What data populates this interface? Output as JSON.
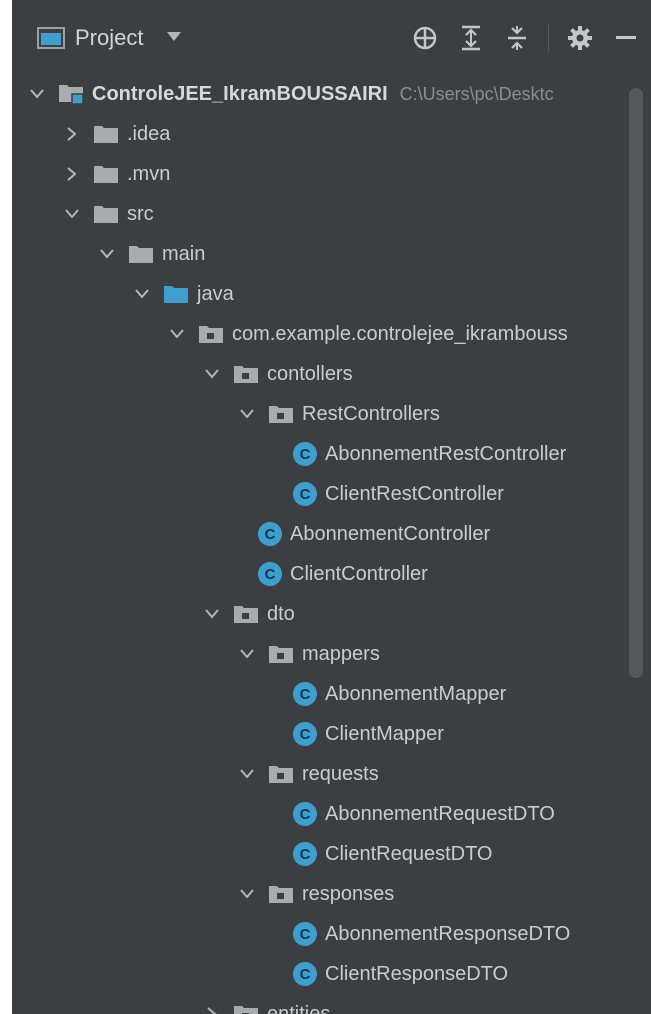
{
  "toolbar": {
    "title": "Project",
    "icons": [
      "locate-icon",
      "expand-all-icon",
      "collapse-all-icon",
      "gear-icon",
      "minimize-icon"
    ]
  },
  "colors": {
    "background": "#3c3f41",
    "text": "#c9cdd1",
    "folder": "#a9acaf",
    "java_folder": "#3e9fcf",
    "class_badge": "#3e9fcf"
  },
  "tree": [
    {
      "label": "ControleJEE_IkramBOUSSAIRI",
      "path": "C:\\Users\\pc\\Desktc",
      "depth": 0,
      "expanded": true,
      "icon": "module-icon",
      "bold": true
    },
    {
      "label": ".idea",
      "depth": 1,
      "expanded": false,
      "icon": "folder-icon"
    },
    {
      "label": ".mvn",
      "depth": 1,
      "expanded": false,
      "icon": "folder-icon"
    },
    {
      "label": "src",
      "depth": 1,
      "expanded": true,
      "icon": "folder-icon"
    },
    {
      "label": "main",
      "depth": 2,
      "expanded": true,
      "icon": "folder-icon"
    },
    {
      "label": "java",
      "depth": 3,
      "expanded": true,
      "icon": "source-folder-icon"
    },
    {
      "label": "com.example.controlejee_ikrambouss",
      "depth": 4,
      "expanded": true,
      "icon": "package-icon"
    },
    {
      "label": "contollers",
      "depth": 5,
      "expanded": true,
      "icon": "package-icon"
    },
    {
      "label": "RestControllers",
      "depth": 6,
      "expanded": true,
      "icon": "package-icon"
    },
    {
      "label": "AbonnementRestController",
      "depth": 7,
      "icon": "class-icon"
    },
    {
      "label": "ClientRestController",
      "depth": 7,
      "icon": "class-icon"
    },
    {
      "label": "AbonnementController",
      "depth": 6,
      "icon": "class-icon"
    },
    {
      "label": "ClientController",
      "depth": 6,
      "icon": "class-icon"
    },
    {
      "label": "dto",
      "depth": 5,
      "expanded": true,
      "icon": "package-icon"
    },
    {
      "label": "mappers",
      "depth": 6,
      "expanded": true,
      "icon": "package-icon"
    },
    {
      "label": "AbonnementMapper",
      "depth": 7,
      "icon": "class-icon"
    },
    {
      "label": "ClientMapper",
      "depth": 7,
      "icon": "class-icon"
    },
    {
      "label": "requests",
      "depth": 6,
      "expanded": true,
      "icon": "package-icon"
    },
    {
      "label": "AbonnementRequestDTO",
      "depth": 7,
      "icon": "class-icon"
    },
    {
      "label": "ClientRequestDTO",
      "depth": 7,
      "icon": "class-icon"
    },
    {
      "label": "responses",
      "depth": 6,
      "expanded": true,
      "icon": "package-icon"
    },
    {
      "label": "AbonnementResponseDTO",
      "depth": 7,
      "icon": "class-icon"
    },
    {
      "label": "ClientResponseDTO",
      "depth": 7,
      "icon": "class-icon"
    },
    {
      "label": "entities",
      "depth": 5,
      "expanded": false,
      "icon": "package-icon"
    }
  ]
}
